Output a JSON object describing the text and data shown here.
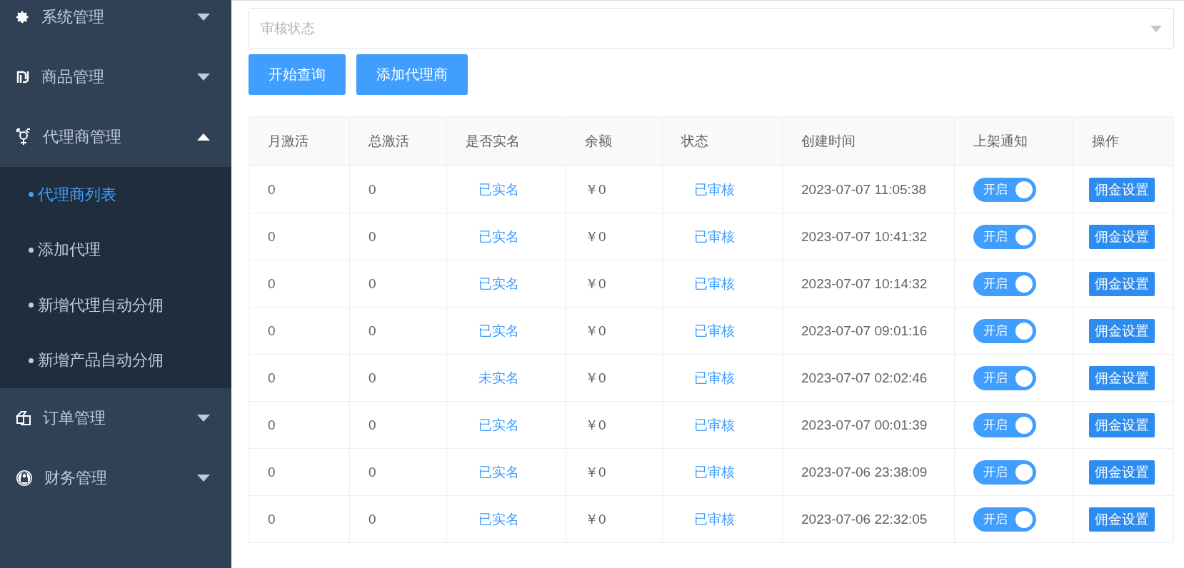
{
  "sidebar": {
    "items": [
      {
        "label": "系统管理",
        "expanded": false
      },
      {
        "label": "商品管理",
        "expanded": false
      },
      {
        "label": "代理商管理",
        "expanded": true,
        "children": [
          {
            "label": "代理商列表",
            "selected": true
          },
          {
            "label": "添加代理",
            "selected": false
          },
          {
            "label": "新增代理自动分佣",
            "selected": false
          },
          {
            "label": "新增产品自动分佣",
            "selected": false
          }
        ]
      },
      {
        "label": "订单管理",
        "expanded": false
      },
      {
        "label": "财务管理",
        "expanded": false
      }
    ]
  },
  "filter": {
    "placeholder": "审核状态"
  },
  "buttons": [
    "开始查询",
    "添加代理商"
  ],
  "table": {
    "columns": [
      "月激活",
      "总激活",
      "是否实名",
      "余额",
      "状态",
      "创建时间",
      "上架通知",
      "操作"
    ],
    "rows": [
      {
        "monthly": "0",
        "total": "0",
        "realname": "已实名",
        "balance": "￥0",
        "status": "已审核",
        "created": "2023-07-07 11:05:38",
        "notify": {
          "label": "开启",
          "on": true
        },
        "action": "佣金设置"
      },
      {
        "monthly": "0",
        "total": "0",
        "realname": "已实名",
        "balance": "￥0",
        "status": "已审核",
        "created": "2023-07-07 10:41:32",
        "notify": {
          "label": "开启",
          "on": true
        },
        "action": "佣金设置"
      },
      {
        "monthly": "0",
        "total": "0",
        "realname": "已实名",
        "balance": "￥0",
        "status": "已审核",
        "created": "2023-07-07 10:14:32",
        "notify": {
          "label": "开启",
          "on": true
        },
        "action": "佣金设置"
      },
      {
        "monthly": "0",
        "total": "0",
        "realname": "已实名",
        "balance": "￥0",
        "status": "已审核",
        "created": "2023-07-07 09:01:16",
        "notify": {
          "label": "开启",
          "on": true
        },
        "action": "佣金设置"
      },
      {
        "monthly": "0",
        "total": "0",
        "realname": "未实名",
        "balance": "￥0",
        "status": "已审核",
        "created": "2023-07-07 02:02:46",
        "notify": {
          "label": "开启",
          "on": true
        },
        "action": "佣金设置"
      },
      {
        "monthly": "0",
        "total": "0",
        "realname": "已实名",
        "balance": "￥0",
        "status": "已审核",
        "created": "2023-07-07 00:01:39",
        "notify": {
          "label": "开启",
          "on": true
        },
        "action": "佣金设置"
      },
      {
        "monthly": "0",
        "total": "0",
        "realname": "已实名",
        "balance": "￥0",
        "status": "已审核",
        "created": "2023-07-06 23:38:09",
        "notify": {
          "label": "开启",
          "on": true
        },
        "action": "佣金设置"
      },
      {
        "monthly": "0",
        "total": "0",
        "realname": "已实名",
        "balance": "￥0",
        "status": "已审核",
        "created": "2023-07-06 22:32:05",
        "notify": {
          "label": "开启",
          "on": true
        },
        "action": "佣金设置"
      }
    ]
  }
}
